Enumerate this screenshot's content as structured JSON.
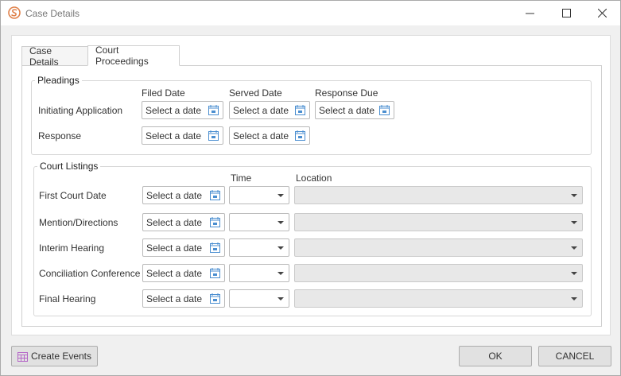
{
  "window": {
    "title": "Case Details"
  },
  "tabs": [
    {
      "label": "Case Details"
    },
    {
      "label": "Court Proceedings"
    }
  ],
  "pleadings": {
    "legend": "Pleadings",
    "headers": {
      "filed": "Filed Date",
      "served": "Served Date",
      "response_due": "Response Due"
    },
    "rows": [
      {
        "label": "Initiating Application"
      },
      {
        "label": "Response"
      }
    ],
    "date_placeholder": "Select a date"
  },
  "court_listings": {
    "legend": "Court Listings",
    "headers": {
      "time": "Time",
      "location": "Location"
    },
    "rows": [
      {
        "label": "First Court Date"
      },
      {
        "label": "Mention/Directions"
      },
      {
        "label": "Interim Hearing"
      },
      {
        "label": "Conciliation Conference"
      },
      {
        "label": "Final Hearing"
      }
    ],
    "date_placeholder": "Select a date"
  },
  "footer": {
    "create_events": "Create Events",
    "ok": "OK",
    "cancel": "CANCEL"
  },
  "colors": {
    "accent_icon": "#e0814a",
    "calendar_icon": "#4a8ed0",
    "create_events_icon": "#b565c8"
  }
}
